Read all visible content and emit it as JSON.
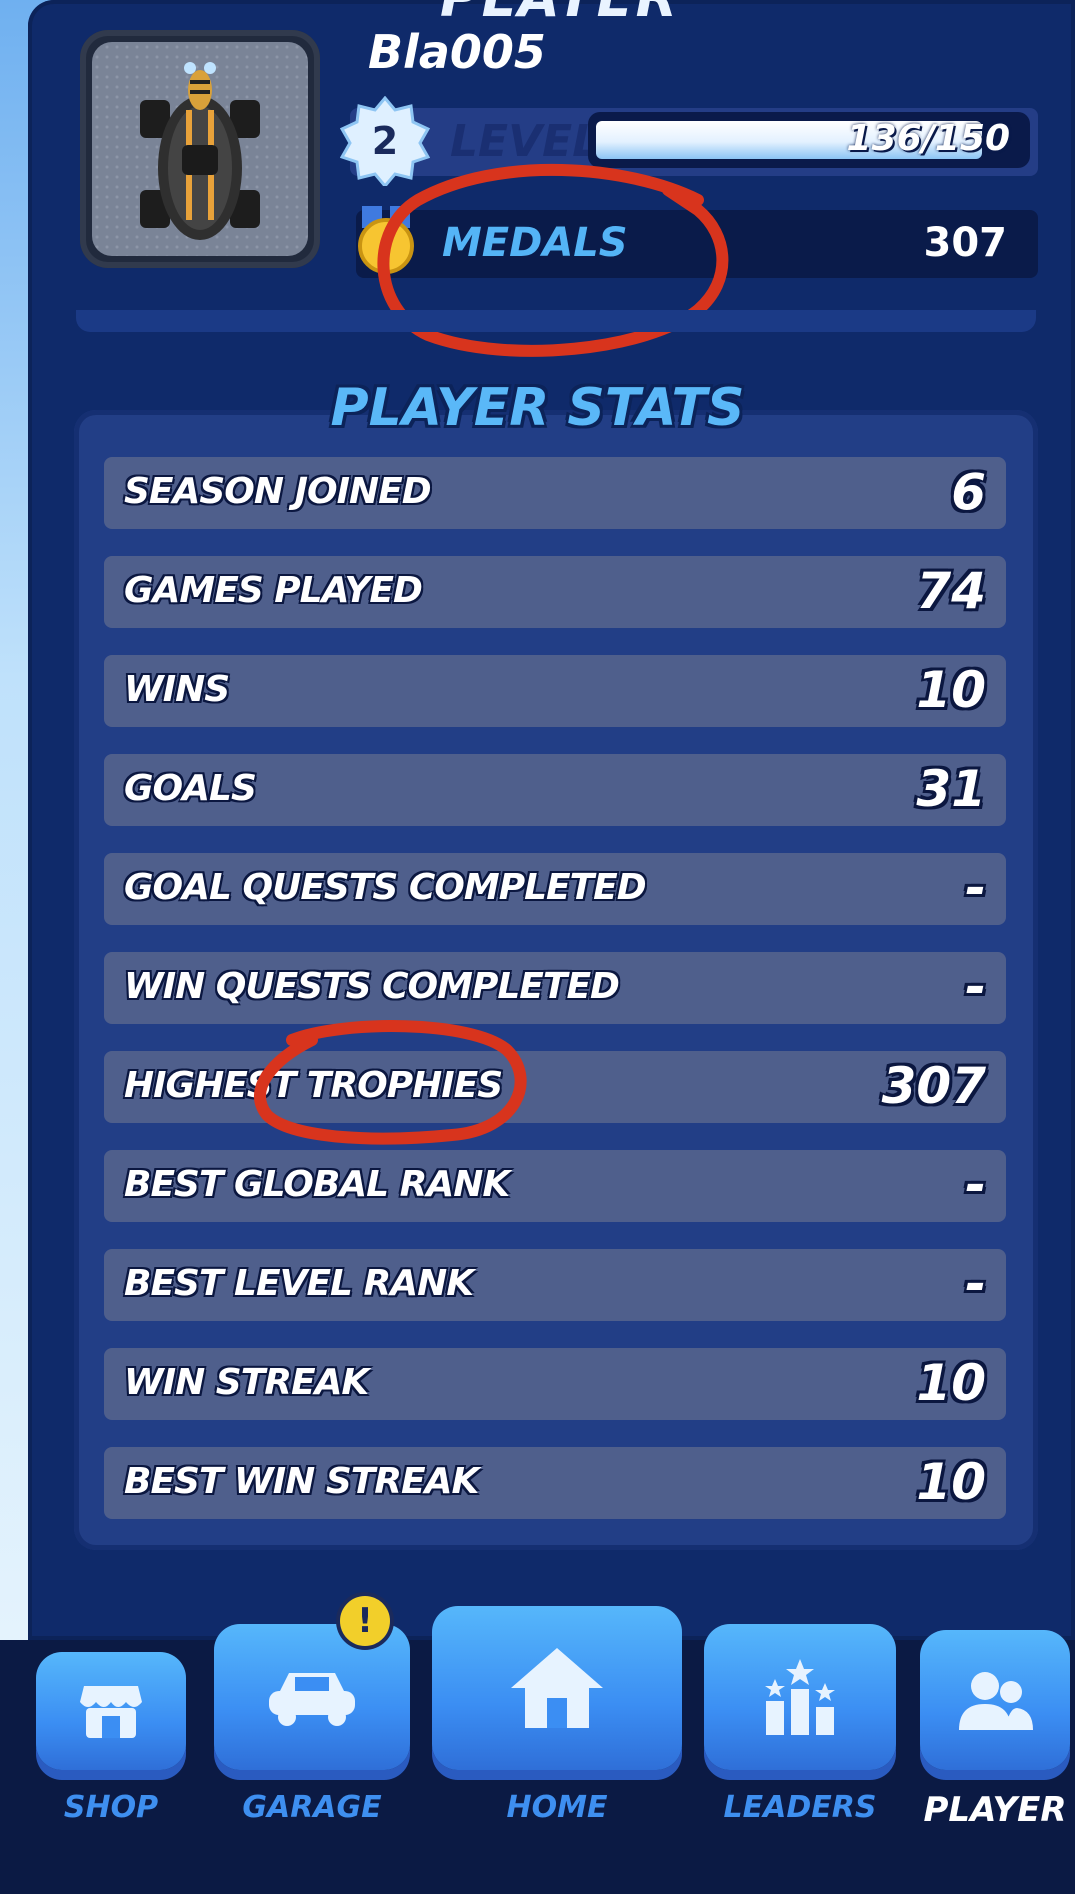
{
  "screen_title": "PLAYER",
  "player": {
    "name": "Bla005",
    "level": "2",
    "level_label": "LEVEL",
    "xp_text": "136/150",
    "xp_progress": 0.907,
    "medals_label": "MEDALS",
    "medals_value": "307"
  },
  "stats": {
    "title": "PLAYER STATS",
    "rows": [
      {
        "label": "SEASON JOINED",
        "value": "6"
      },
      {
        "label": "GAMES PLAYED",
        "value": "74"
      },
      {
        "label": "WINS",
        "value": "10"
      },
      {
        "label": "GOALS",
        "value": "31"
      },
      {
        "label": "GOAL QUESTS COMPLETED",
        "value": "-"
      },
      {
        "label": "WIN QUESTS COMPLETED",
        "value": "-"
      },
      {
        "label": "HIGHEST TROPHIES",
        "value": "307"
      },
      {
        "label": "BEST GLOBAL RANK",
        "value": "-"
      },
      {
        "label": "BEST LEVEL RANK",
        "value": "-"
      },
      {
        "label": "WIN STREAK",
        "value": "10"
      },
      {
        "label": "BEST WIN STREAK",
        "value": "10"
      }
    ]
  },
  "nav": {
    "shop": "SHOP",
    "garage": "GARAGE",
    "home": "HOME",
    "leaders": "LEADERS",
    "player": "PLAYER",
    "garage_alert": "!"
  },
  "icons": {
    "shop": "shop-icon",
    "garage": "car-icon",
    "home": "home-icon",
    "leaders": "podium-icon",
    "player": "users-icon",
    "medal": "medal-icon"
  },
  "colors": {
    "panel": "#0f2a6a",
    "accent": "#54b4f6",
    "stat_row": "#4f5f8c",
    "annotation_red": "#d8341d"
  }
}
